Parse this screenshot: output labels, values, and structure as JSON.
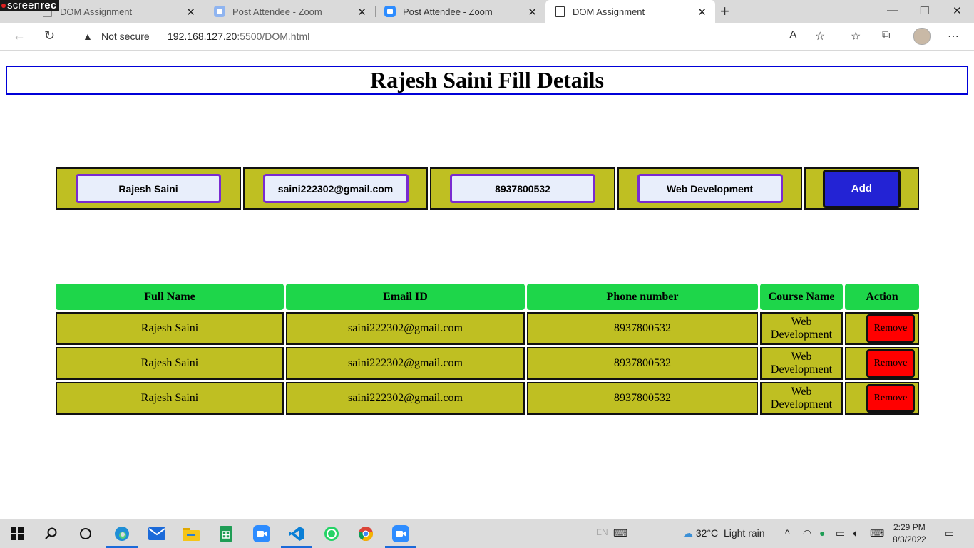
{
  "browser": {
    "tabs": [
      {
        "label": "DOM Assignment",
        "favicon": "page-icon",
        "active": false
      },
      {
        "label": "Post Attendee - Zoom",
        "favicon": "zoom-icon",
        "active": false
      },
      {
        "label": "Post Attendee - Zoom",
        "favicon": "zoom-icon",
        "active": false
      },
      {
        "label": "DOM Assignment",
        "favicon": "page-icon",
        "active": true
      }
    ],
    "security_label": "Not secure",
    "url_host": "192.168.127.20",
    "url_path": ":5500/DOM.html"
  },
  "overlay": {
    "brand_light": "screen",
    "brand_bold": "rec"
  },
  "page": {
    "title": "Rajesh Saini Fill Details",
    "form": {
      "name": "Rajesh Saini",
      "email": "saini222302@gmail.com",
      "phone": "8937800532",
      "course": "Web Development",
      "add_label": "Add"
    },
    "table": {
      "headers": [
        "Full Name",
        "Email ID",
        "Phone number",
        "Course Name",
        "Action"
      ],
      "rows": [
        {
          "name": "Rajesh Saini",
          "email": "saini222302@gmail.com",
          "phone": "8937800532",
          "course": "Web Development",
          "action": "Remove"
        },
        {
          "name": "Rajesh Saini",
          "email": "saini222302@gmail.com",
          "phone": "8937800532",
          "course": "Web Development",
          "action": "Remove"
        },
        {
          "name": "Rajesh Saini",
          "email": "saini222302@gmail.com",
          "phone": "8937800532",
          "course": "Web Development",
          "action": "Remove"
        }
      ]
    }
  },
  "taskbar": {
    "lang": "EN",
    "weather_temp": "32°C",
    "weather_desc": "Light rain",
    "time": "2:29 PM",
    "date": "8/3/2022"
  },
  "colors": {
    "cell_olive": "#bfbf22",
    "header_green": "#1ed64a",
    "add_blue": "#2323d4",
    "remove_red": "#ff0000",
    "title_border": "#0000d8",
    "input_border": "#7a2bd0"
  }
}
